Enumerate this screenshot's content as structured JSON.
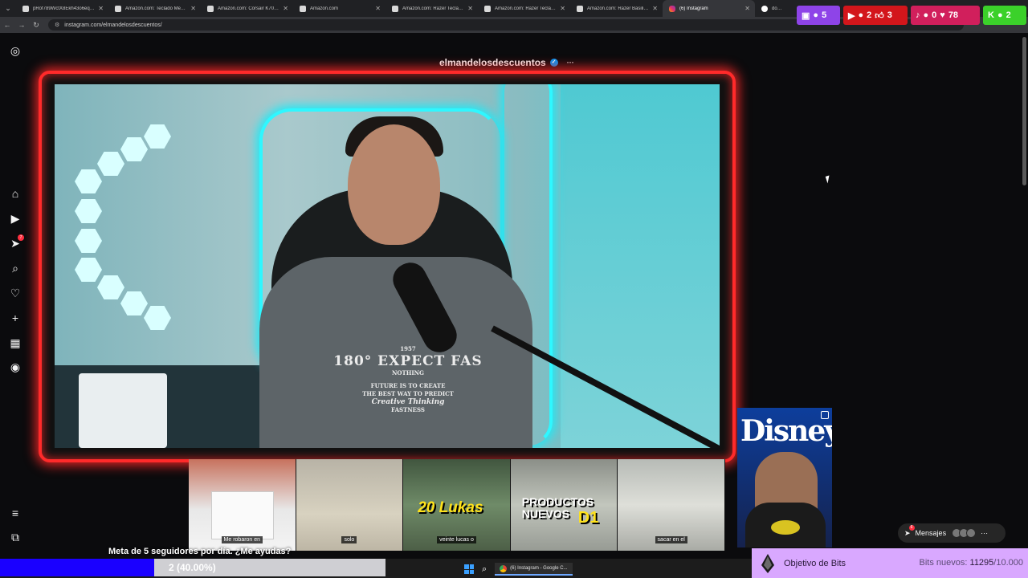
{
  "browser": {
    "tabs": [
      {
        "title": "pRof789WctX8Ekh43o6eqk..."
      },
      {
        "title": "Amazon.com: Teclado Mecan..."
      },
      {
        "title": "Amazon.com: Corsair K70 Co..."
      },
      {
        "title": "Amazon.com"
      },
      {
        "title": "Amazon.com: Razer Teclado ..."
      },
      {
        "title": "Amazon.com: Razer Teclado ..."
      },
      {
        "title": "Amazon.com: Razer Basilisk V..."
      },
      {
        "title": "(6) Instagram"
      },
      {
        "title": "donde e..."
      }
    ],
    "url": "instagram.com/elmandelosdescuentos/"
  },
  "stream_badges": {
    "twitch": "5",
    "youtube_viewers": "2",
    "youtube_likes": "3",
    "tiktok_viewers": "0",
    "tiktok_likes": "78",
    "kick": "2"
  },
  "profile": {
    "username": "elmandelosdescuentos",
    "verified_glyph": "✓",
    "more_glyph": "···"
  },
  "rail": {
    "notification_badge": "7"
  },
  "shirt": {
    "line1": "1957",
    "line2": "180° EXPECT FAS",
    "line3": "NOTHING",
    "line4": "FUTURE IS TO CREATE",
    "line5": "THE BEST WAY TO PREDICT",
    "line6": "Creative Thinking",
    "line7": "FASTNESS"
  },
  "disney": {
    "logo": "Disney+"
  },
  "reels": [
    {
      "caption": "Me robaron en"
    },
    {
      "caption": "solo"
    },
    {
      "big_text": "20 Lukas",
      "caption": "veinte lucas o"
    },
    {
      "title_line1": "PRODUCTOS",
      "title_line2": "NUEVOS",
      "title_accent": "D1",
      "caption": ""
    },
    {
      "caption": "sacar en el"
    }
  ],
  "overlay": {
    "goal_text": "Meta de 5 seguidores por día. ¿Me ayudas?",
    "progress_label": "2 (40.00%)",
    "progress_fraction": 0.4
  },
  "bits": {
    "label": "Objetivo de Bits",
    "count_prefix": "Bits nuevos: ",
    "count_current": "11295",
    "count_total": "/10.000"
  },
  "messages": {
    "label": "Mensajes",
    "badge": "6"
  },
  "taskbar": {
    "chrome_window": "(6) Instagram - Google C..."
  },
  "colors": {
    "frame_red": "#ff2a2a",
    "progress_blue": "#1a00ff",
    "bits_purple": "#d9a8ff",
    "instagram_blue": "#0095f6"
  }
}
